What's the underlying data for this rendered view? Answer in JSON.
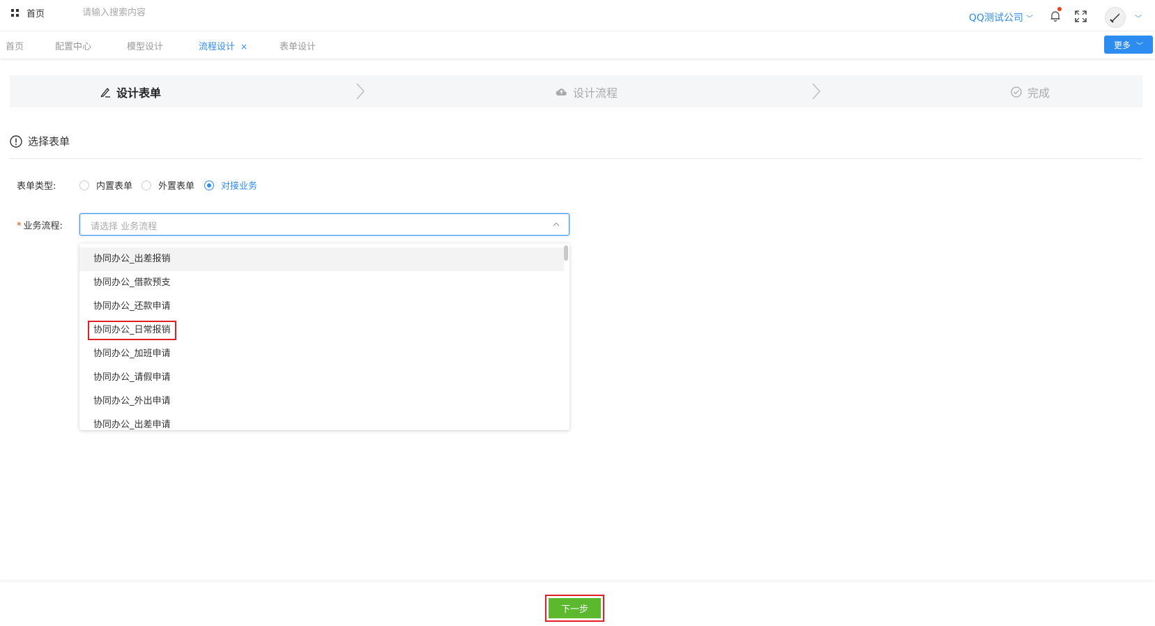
{
  "header": {
    "home_label": "首页",
    "search_placeholder": "请输入搜索内容",
    "company_label": "QQ测试公司",
    "icons": [
      "grid-icon",
      "bell-icon",
      "fullscreen-icon",
      "avatar",
      "chevron-down-icon"
    ]
  },
  "tabs": [
    {
      "label": "首页",
      "active": false
    },
    {
      "label": "配置中心",
      "active": false
    },
    {
      "label": "模型设计",
      "active": false
    },
    {
      "label": "流程设计",
      "active": true,
      "close": "×"
    },
    {
      "label": "表单设计",
      "active": false
    }
  ],
  "more_button": {
    "label": "更多"
  },
  "steps": [
    {
      "label": "设计表单",
      "icon": "edit-icon",
      "active": true
    },
    {
      "label": "设计流程",
      "icon": "cloud-icon",
      "active": false
    },
    {
      "label": "完成",
      "icon": "check-circle-icon",
      "active": false
    }
  ],
  "section": {
    "title": "选择表单",
    "icon": "info-circle-icon"
  },
  "form": {
    "type_label": "表单类型:",
    "type_options": [
      {
        "label": "内置表单",
        "checked": false
      },
      {
        "label": "外置表单",
        "checked": false
      },
      {
        "label": "对接业务",
        "checked": true
      }
    ],
    "required_mark": "*",
    "process_label": "业务流程:",
    "process_placeholder": "请选择 业务流程"
  },
  "dropdown": {
    "options": [
      "协同办公_出差报销",
      "协同办公_借款预支",
      "协同办公_还款申请",
      "协同办公_日常报销",
      "协同办公_加班申请",
      "协同办公_请假申请",
      "协同办公_外出申请",
      "协同办公_出差申请"
    ],
    "hovered_index": 0,
    "highlighted_index": 3
  },
  "footer": {
    "next_label": "下一步"
  },
  "colors": {
    "primary": "#2d8cf0",
    "success": "#5cb82d",
    "highlight": "#e02020",
    "notify_dot": "#ed4014"
  }
}
